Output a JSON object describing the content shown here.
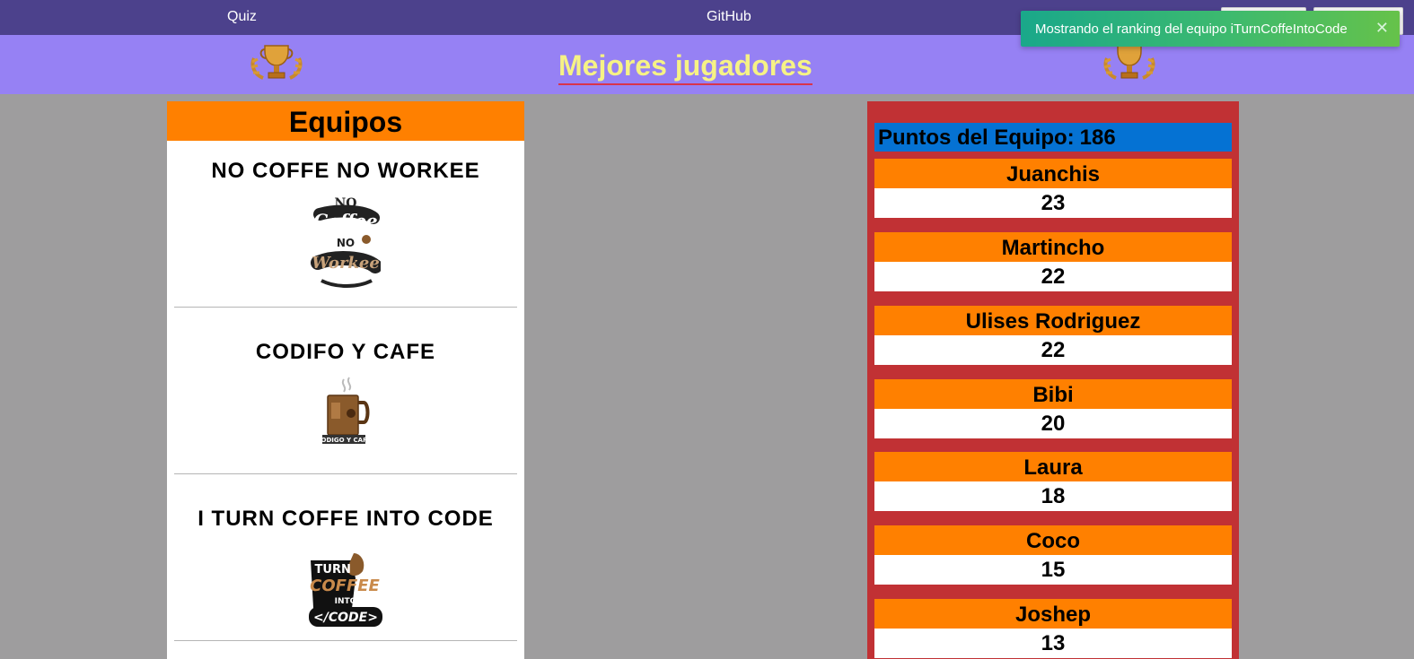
{
  "nav": {
    "quiz_label": "Quiz",
    "github_label": "GitHub"
  },
  "header": {
    "title": "Mejores jugadores",
    "trophy_icon": "trophy-icon",
    "title_color": "#f6f285",
    "background": "#9681f4"
  },
  "toast": {
    "message": "Mostrando el ranking del equipo iTurnCoffeIntoCode",
    "close_label": "✕"
  },
  "teams": {
    "heading": "Equipos",
    "heading_color": "#ff8000",
    "items": [
      {
        "name": "NO COFFE NO WORKEE",
        "logo_text": "No Coffee No Workee",
        "logo": "no-coffee-no-workee-logo"
      },
      {
        "name": "CODIFO Y CAFE",
        "logo_text": "CODIGO Y CAFE",
        "logo": "coffee-mug-logo"
      },
      {
        "name": "I TURN COFFE INTO CODE",
        "logo_text": "I TURN COFFEE INTO </CODE>",
        "logo": "i-turn-coffee-into-code-logo"
      }
    ]
  },
  "ranking": {
    "points_label": "Puntos del Equipo:",
    "points_value": "186",
    "panel_color": "#c13134",
    "points_color": "#0572d3",
    "players": [
      {
        "name": "Juanchis",
        "score": "23"
      },
      {
        "name": "Martincho",
        "score": "22"
      },
      {
        "name": "Ulises Rodriguez",
        "score": "22"
      },
      {
        "name": "Bibi",
        "score": "20"
      },
      {
        "name": "Laura",
        "score": "18"
      },
      {
        "name": "Coco",
        "score": "15"
      },
      {
        "name": "Joshep",
        "score": "13"
      }
    ]
  }
}
